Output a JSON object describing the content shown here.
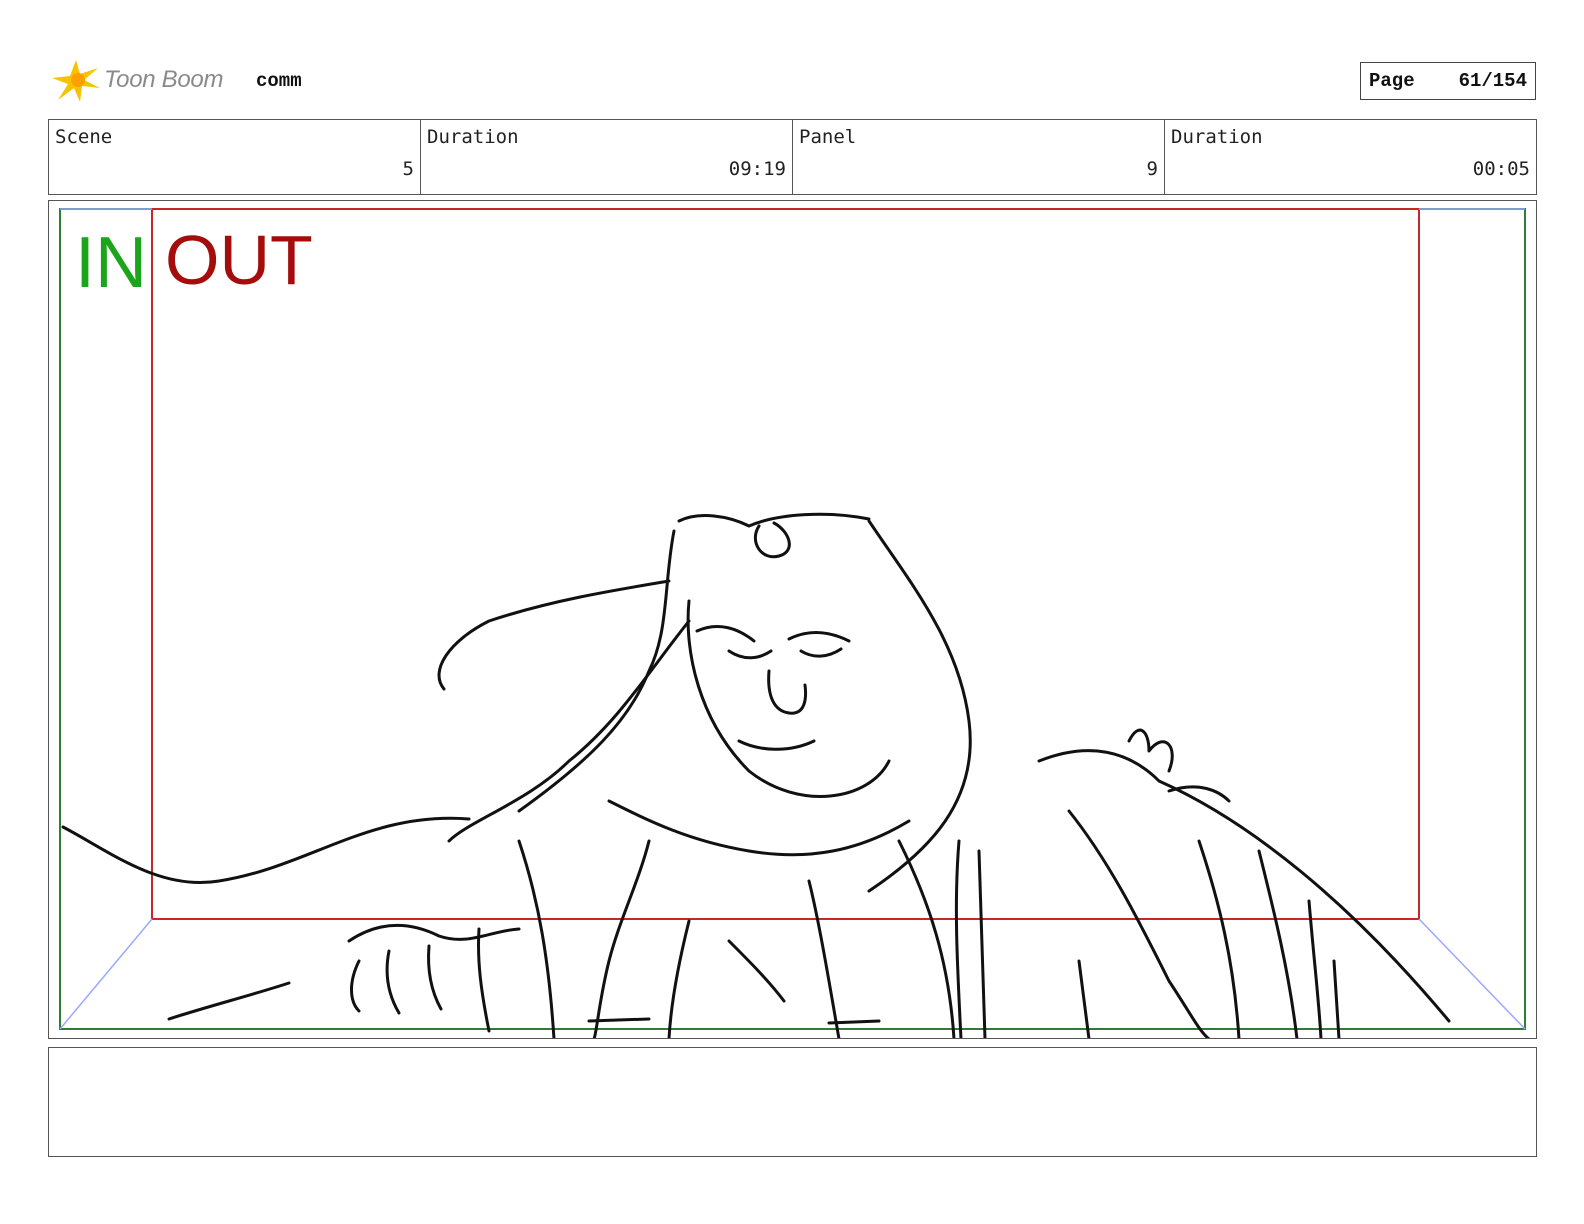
{
  "header": {
    "logo_text": "Toon Boom",
    "project_name": "comm",
    "page_label": "Page",
    "page_value": "61/154"
  },
  "info": {
    "scene_label": "Scene",
    "scene_value": "5",
    "scene_duration_label": "Duration",
    "scene_duration_value": "09:19",
    "panel_label": "Panel",
    "panel_value": "9",
    "panel_duration_label": "Duration",
    "panel_duration_value": "00:05"
  },
  "panel": {
    "in_label": "IN",
    "out_label": "OUT",
    "in_color": "#1aa51a",
    "out_color": "#a50d0d",
    "in_frame_color": "#2e7d32",
    "out_frame_color": "#c62828",
    "motion_arrow_color": "#9aa8ff"
  },
  "notes": {
    "text": ""
  }
}
